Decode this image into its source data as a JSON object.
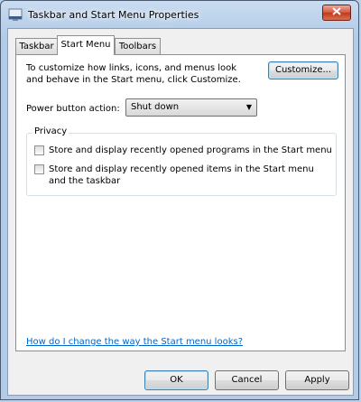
{
  "window": {
    "title": "Taskbar and Start Menu Properties",
    "icon": "taskbar-properties-icon",
    "close_icon": "close-icon"
  },
  "tabs": [
    {
      "label": "Taskbar",
      "active": false
    },
    {
      "label": "Start Menu",
      "active": true
    },
    {
      "label": "Toolbars",
      "active": false
    }
  ],
  "start_menu": {
    "description": "To customize how links, icons, and menus look and behave in the Start menu, click Customize.",
    "customize_label": "Customize...",
    "power_button_label": "Power button action:",
    "power_button_value": "Shut down",
    "privacy": {
      "title": "Privacy",
      "options": [
        {
          "label": "Store and display recently opened programs in the Start menu",
          "checked": false
        },
        {
          "label": "Store and display recently opened items in the Start menu and the taskbar",
          "checked": false
        }
      ]
    },
    "help_link": "How do I change the way the Start menu looks?"
  },
  "footer": {
    "ok_label": "OK",
    "cancel_label": "Cancel",
    "apply_label": "Apply"
  },
  "colors": {
    "link": "#0066cc",
    "close_button": "#c0391f",
    "frame": "#b3cbe6"
  }
}
